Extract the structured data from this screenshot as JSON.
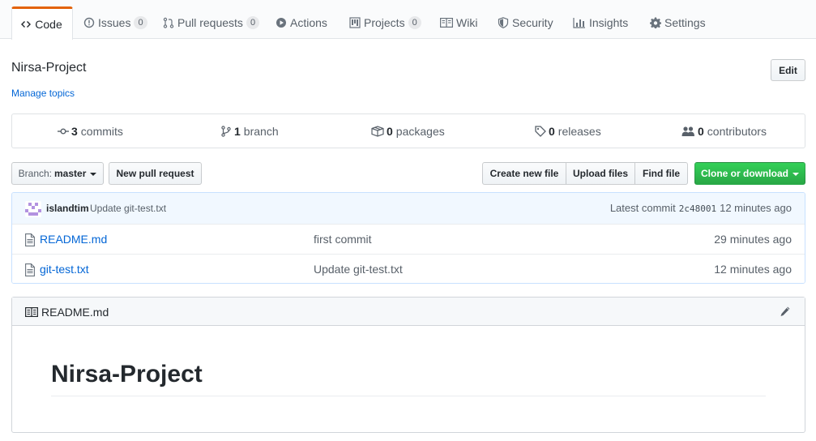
{
  "tabs": [
    {
      "label": "Code",
      "icon": "code-icon",
      "counter": null
    },
    {
      "label": "Issues",
      "icon": "issue-icon",
      "counter": "0"
    },
    {
      "label": "Pull requests",
      "icon": "pull-request-icon",
      "counter": "0"
    },
    {
      "label": "Actions",
      "icon": "play-icon",
      "counter": null
    },
    {
      "label": "Projects",
      "icon": "project-icon",
      "counter": "0"
    },
    {
      "label": "Wiki",
      "icon": "book-icon",
      "counter": null
    },
    {
      "label": "Security",
      "icon": "shield-icon",
      "counter": null
    },
    {
      "label": "Insights",
      "icon": "graph-icon",
      "counter": null
    },
    {
      "label": "Settings",
      "icon": "gear-icon",
      "counter": null
    }
  ],
  "repo": {
    "title": "Nirsa-Project",
    "manage_topics": "Manage topics",
    "edit_label": "Edit"
  },
  "summary": {
    "commits": {
      "num": "3",
      "label": "commits"
    },
    "branches": {
      "num": "1",
      "label": "branch"
    },
    "packages": {
      "num": "0",
      "label": "packages"
    },
    "releases": {
      "num": "0",
      "label": "releases"
    },
    "contributors": {
      "num": "0",
      "label": "contributors"
    }
  },
  "filenav": {
    "branch_prefix": "Branch:",
    "branch_value": "master",
    "new_pr": "New pull request",
    "create_file": "Create new file",
    "upload_files": "Upload files",
    "find_file": "Find file",
    "clone": "Clone or download"
  },
  "commit_tease": {
    "author": "islandtim",
    "message": "Update git-test.txt",
    "latest_label": "Latest commit",
    "sha": "2c48001",
    "age": "12 minutes ago"
  },
  "files": [
    {
      "name": "README.md",
      "message": "first commit",
      "age": "29 minutes ago"
    },
    {
      "name": "git-test.txt",
      "message": "Update git-test.txt",
      "age": "12 minutes ago"
    }
  ],
  "readme": {
    "filename": "README.md",
    "heading": "Nirsa-Project"
  },
  "colors": {
    "accent_tab": "#e36209",
    "link": "#0366d6",
    "primary_button": "#2cbe4e",
    "avatar": "#b392e0"
  }
}
